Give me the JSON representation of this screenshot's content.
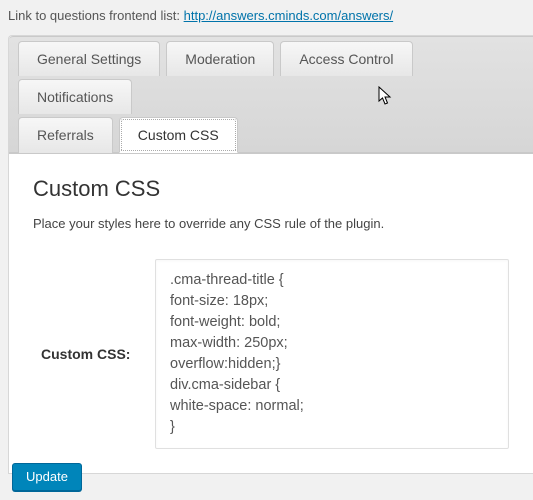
{
  "top_link": {
    "prefix": "Link to questions frontend list: ",
    "url_text": "http://answers.cminds.com/answers/"
  },
  "tabs": {
    "general": "General Settings",
    "moderation": "Moderation",
    "access": "Access Control",
    "notifications": "Notifications",
    "referrals": "Referrals",
    "custom_css": "Custom CSS"
  },
  "page": {
    "heading": "Custom CSS",
    "description": "Place your styles here to override any CSS rule of the plugin."
  },
  "form": {
    "css_label": "Custom CSS:",
    "css_value": ".cma-thread-title {\nfont-size: 18px;\nfont-weight: bold;\nmax-width: 250px;\noverflow:hidden;}\ndiv.cma-sidebar {\nwhite-space: normal;\n}"
  },
  "buttons": {
    "update": "Update"
  }
}
